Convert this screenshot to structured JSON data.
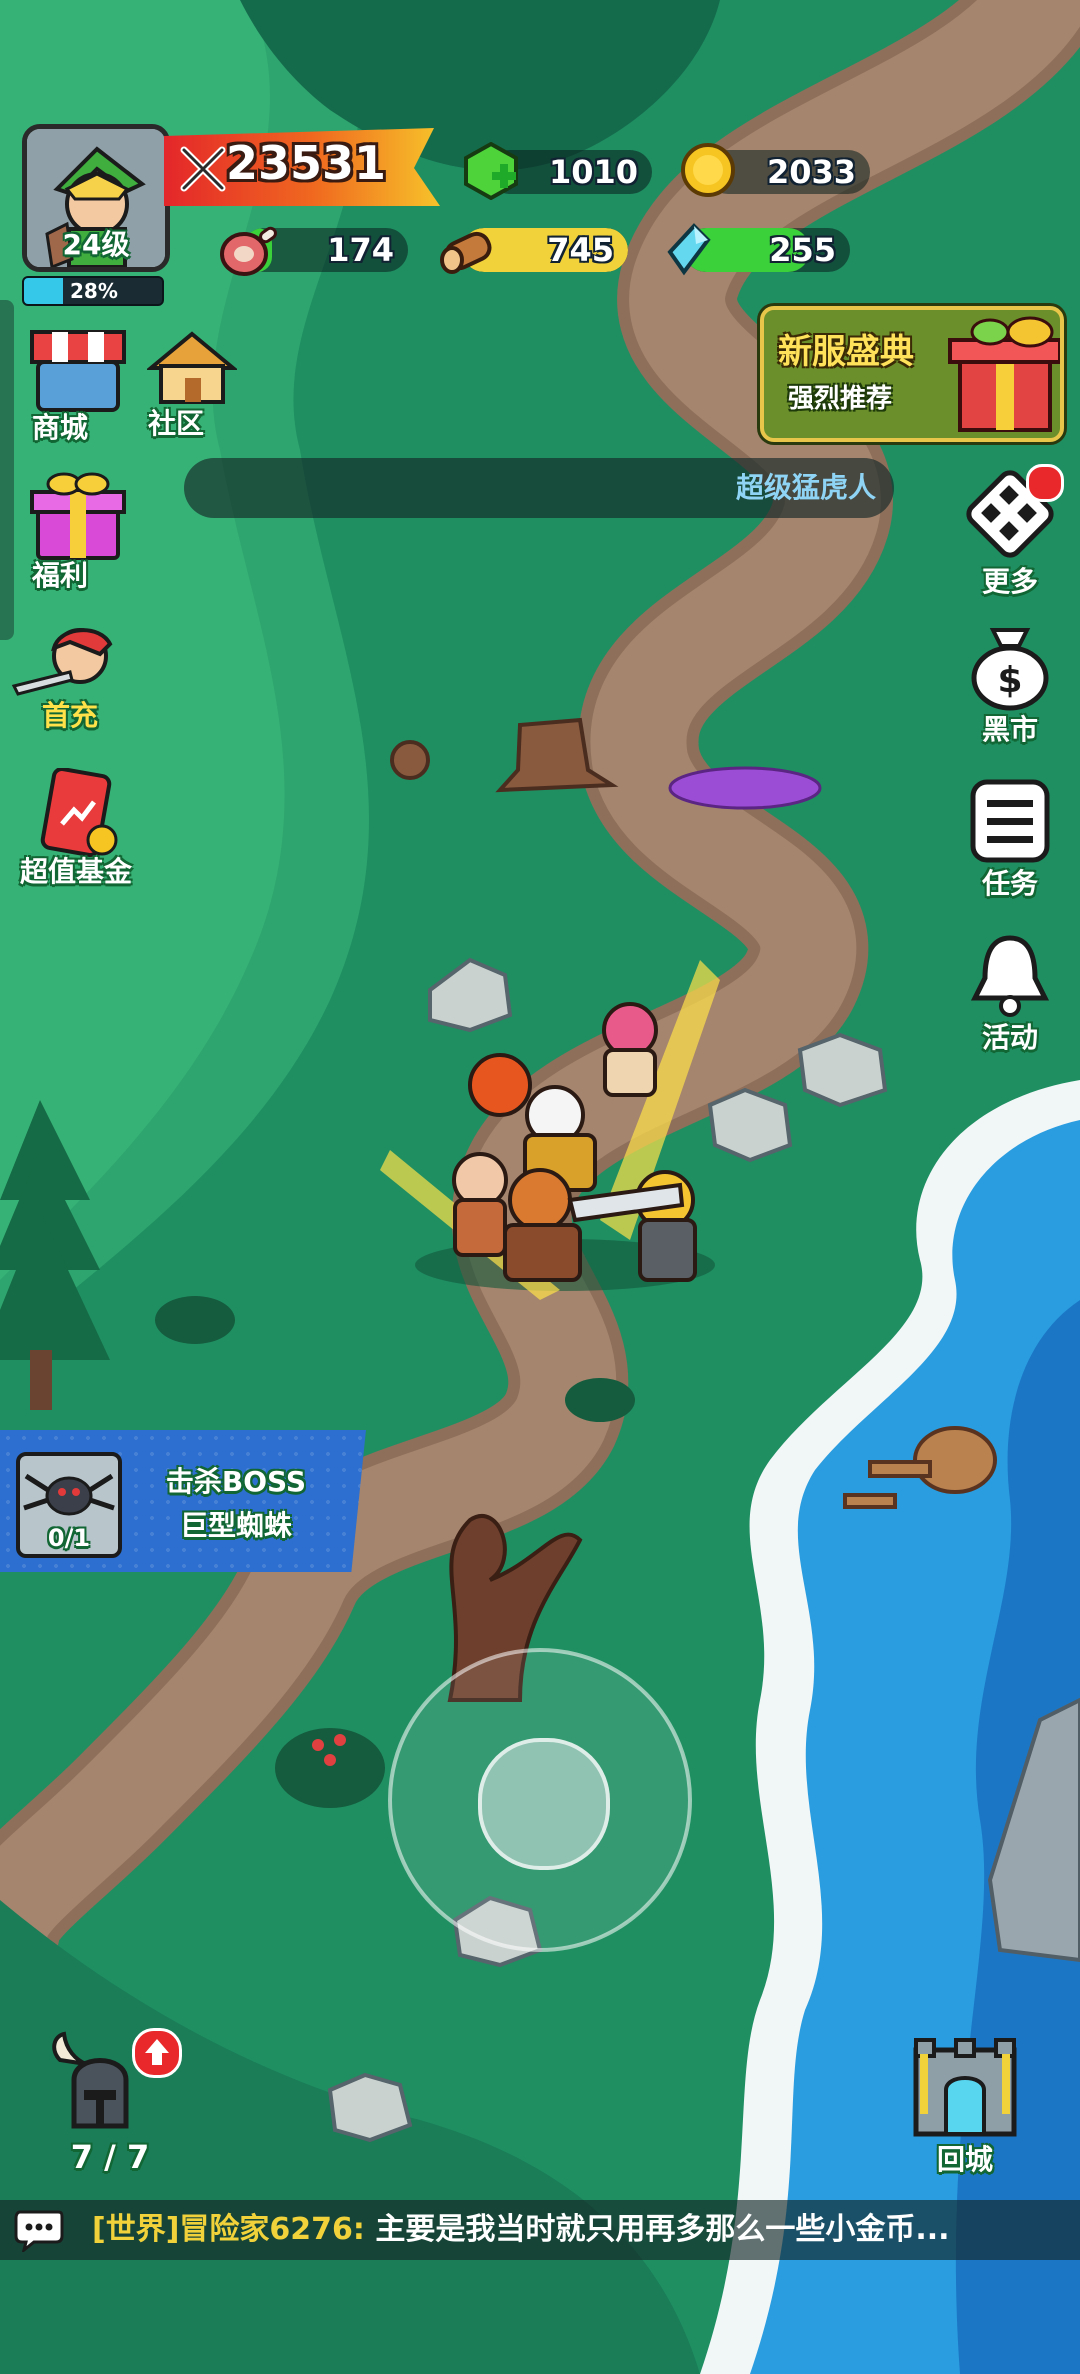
{
  "player": {
    "level_label": "24级",
    "exp_percent_label": "28%",
    "exp_fraction": 0.28,
    "power": "23531"
  },
  "resources": {
    "gems": "1010",
    "gold": "2033",
    "meat": "174",
    "wood": "745",
    "crystal": "255"
  },
  "left_menu": {
    "shop": "商城",
    "community": "社区",
    "welfare": "福利",
    "first_charge": "首充",
    "fund": "超值基金"
  },
  "right_menu": {
    "more": "更多",
    "black_market": "黑市",
    "tasks": "任务",
    "events": "活动"
  },
  "event_banner": {
    "title": "新服盛典",
    "subtitle": "强烈推荐"
  },
  "marquee": {
    "text": "超级猛虎人"
  },
  "quest": {
    "line1": "击杀BOSS",
    "line2": "巨型蜘蛛",
    "progress": "0/1"
  },
  "helmet": {
    "count": "7 / 7"
  },
  "return_city": "回城",
  "chat": {
    "channel": "[世界]",
    "sender": "冒险家6276:",
    "message": "主要是我当时就只用再多那么一些小金币..."
  },
  "colors": {
    "grass": "#1f8f62",
    "path": "#9a7a62",
    "sea": "#1e7fd0",
    "exp_bar": "#35c8e8",
    "meat_bar": "#3ad13a",
    "wood_bar": "#f2d23a",
    "crystal_bar": "#3ad13a"
  }
}
